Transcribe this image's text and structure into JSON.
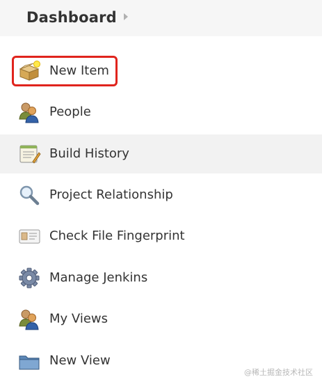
{
  "breadcrumb": {
    "title": "Dashboard"
  },
  "tasks": [
    {
      "label": "New Item",
      "icon": "new-item-box-icon"
    },
    {
      "label": "People",
      "icon": "people-icon"
    },
    {
      "label": "Build History",
      "icon": "build-history-notepad-icon"
    },
    {
      "label": "Project Relationship",
      "icon": "magnifier-icon"
    },
    {
      "label": "Check File Fingerprint",
      "icon": "fingerprint-card-icon"
    },
    {
      "label": "Manage Jenkins",
      "icon": "gear-icon"
    },
    {
      "label": "My Views",
      "icon": "people-icon"
    },
    {
      "label": "New View",
      "icon": "folder-icon"
    }
  ],
  "watermark": "@稀土掘金技术社区",
  "colors": {
    "selection": "#e0241d",
    "highlight_row": "#f2f2f2",
    "header_bg": "#f6f6f6"
  }
}
